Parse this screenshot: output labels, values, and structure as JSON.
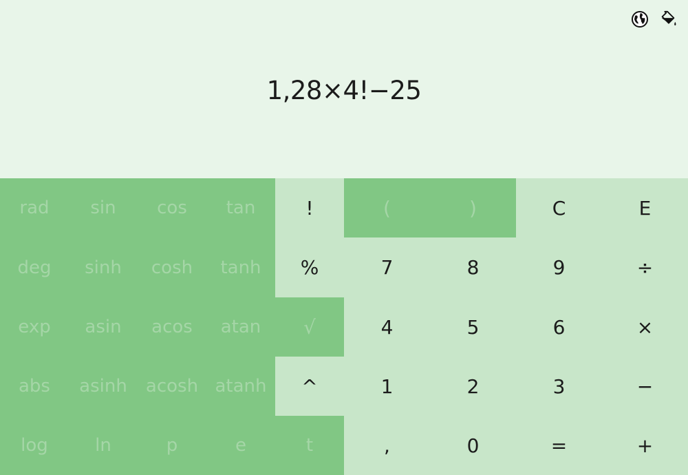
{
  "display": {
    "expression": "1,28×4!−25",
    "icons": [
      "globe-icon",
      "paint-bucket-icon"
    ]
  },
  "colors": {
    "display_bg": "#e8f5e9",
    "panel_dark": "#81c784",
    "panel_light": "#c8e6c9",
    "inactive_text": "#a5d6a7",
    "text": "#1b1b1b"
  },
  "keys": {
    "rad": "rad",
    "sin": "sin",
    "cos": "cos",
    "tan": "tan",
    "deg": "deg",
    "sinh": "sinh",
    "cosh": "cosh",
    "tanh": "tanh",
    "exp": "exp",
    "asin": "asin",
    "acos": "acos",
    "atan": "atan",
    "abs": "abs",
    "asinh": "asinh",
    "acosh": "acosh",
    "atanh": "atanh",
    "log": "log",
    "ln": "ln",
    "pi": "p",
    "e": "e",
    "tau": "t",
    "factorial": "!",
    "percent": "%",
    "sqrt": "√",
    "power": "^",
    "lparen": "(",
    "rparen": ")",
    "clear": "C",
    "backspace": "E",
    "d7": "7",
    "d8": "8",
    "d9": "9",
    "divide": "÷",
    "d4": "4",
    "d5": "5",
    "d6": "6",
    "multiply": "×",
    "d1": "1",
    "d2": "2",
    "d3": "3",
    "minus": "−",
    "comma": ",",
    "d0": "0",
    "equals": "=",
    "plus": "+"
  }
}
